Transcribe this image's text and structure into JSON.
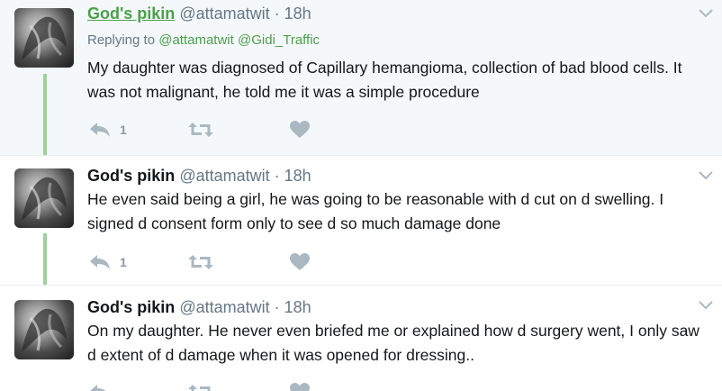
{
  "tweets": [
    {
      "name": "God's pikin",
      "handle": "@attamatwit",
      "separator": "·",
      "time": "18h",
      "replying_label": "Replying to",
      "replying_mentions": "@attamatwit @Gidi_Traffic",
      "text": "My daughter was diagnosed of Capillary hemangioma, collection of bad blood cells. It was not malignant, he told me it was a simple procedure",
      "reply_count": "1"
    },
    {
      "name": "God's pikin",
      "handle": "@attamatwit",
      "separator": "·",
      "time": "18h",
      "text": "He even said being a girl, he was going to be reasonable with d cut on d swelling. I signed d consent form only to see d so much damage done",
      "reply_count": "1"
    },
    {
      "name": "God's pikin",
      "handle": "@attamatwit",
      "separator": "·",
      "time": "18h",
      "text": "On my daughter. He never even briefed me or explained how d surgery went, I only saw d extent of d damage when it was opened for dressing.."
    }
  ],
  "colors": {
    "thread_line": "#9ed09a",
    "mention": "#4aa04a",
    "muted": "#657786",
    "action_icon": "#aab8c2",
    "highlight_bg": "#f5f8fa"
  },
  "icons": {
    "reply": "reply-icon",
    "retweet": "retweet-icon",
    "like": "heart-icon",
    "menu": "chevron-down-icon"
  }
}
